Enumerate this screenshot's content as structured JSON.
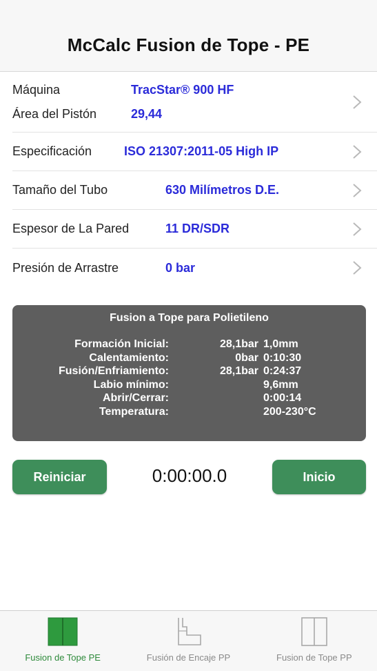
{
  "header": {
    "title": "McCalc Fusion de Tope - PE"
  },
  "settings": {
    "machine": {
      "label": "Máquina",
      "value": "TracStar® 900 HF"
    },
    "piston_area": {
      "label": "Área del Pistón",
      "value": "29,44"
    },
    "spec": {
      "label": "Especificación",
      "value": "ISO 21307:2011-05 High IP"
    },
    "pipe_size": {
      "label": "Tamaño del Tubo",
      "value": "630 Milímetros D.E."
    },
    "wall": {
      "label": "Espesor de La Pared",
      "value": "11 DR/SDR"
    },
    "drag": {
      "label": "Presión de Arrastre",
      "value": "0 bar"
    }
  },
  "results": {
    "title": "Fusion a Tope para Polietileno",
    "rows": [
      {
        "label": "Formación Inicial:",
        "v1": "28,1bar",
        "v2": "1,0mm"
      },
      {
        "label": "Calentamiento:",
        "v1": "0bar",
        "v2": "0:10:30"
      },
      {
        "label": "Fusión/Enfriamiento:",
        "v1": "28,1bar",
        "v2": "0:24:37"
      },
      {
        "label": "Labio mínimo:",
        "v1": "",
        "v2": "9,6mm"
      },
      {
        "label": "Abrir/Cerrar:",
        "v1": "",
        "v2": "0:00:14"
      },
      {
        "label": "Temperatura:",
        "v1": "",
        "v2": "200-230°C"
      }
    ]
  },
  "controls": {
    "reset_label": "Reiniciar",
    "timer": "0:00:00.0",
    "start_label": "Inicio"
  },
  "tabs": [
    {
      "label": "Fusion de Tope PE",
      "icon": "butt-fusion-pe-icon",
      "active": true
    },
    {
      "label": "Fusión de Encaje PP",
      "icon": "socket-fusion-pp-icon",
      "active": false
    },
    {
      "label": "Fusion de Tope PP",
      "icon": "butt-fusion-pp-icon",
      "active": false
    }
  ],
  "colors": {
    "accent_green": "#3e8e5a",
    "value_blue": "#2b2bd9",
    "panel_gray": "#5e5e5e"
  }
}
